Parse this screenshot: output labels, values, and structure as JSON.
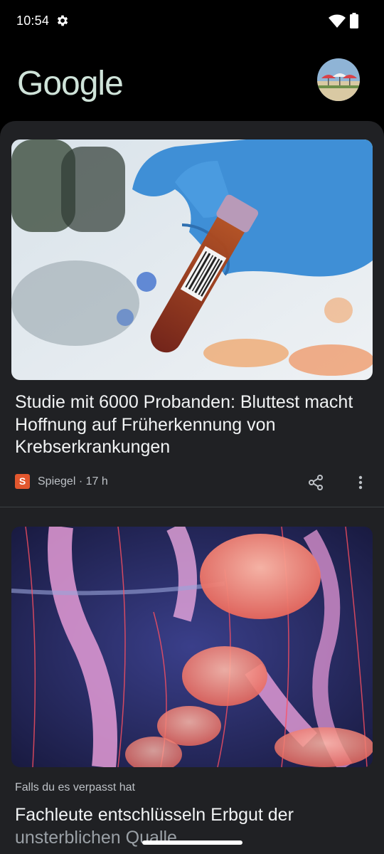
{
  "status_bar": {
    "time": "10:54"
  },
  "header": {
    "logo_text": "Google"
  },
  "articles": [
    {
      "title": "Studie mit 6000 Probanden: Bluttest macht Hoffnung auf Früherkennung von Krebserkrankungen",
      "source_logo_letter": "S",
      "source": "Spiegel · 17 h"
    },
    {
      "kicker": "Falls du es verpasst hat",
      "title_line1": "Fachleute entschlüsseln Erbgut der",
      "title_line2": "unsterblichen Qualle"
    }
  ],
  "colors": {
    "background": "#000000",
    "card": "#202124",
    "source_logo": "#e2572e",
    "logo": "#cfe3d9"
  }
}
